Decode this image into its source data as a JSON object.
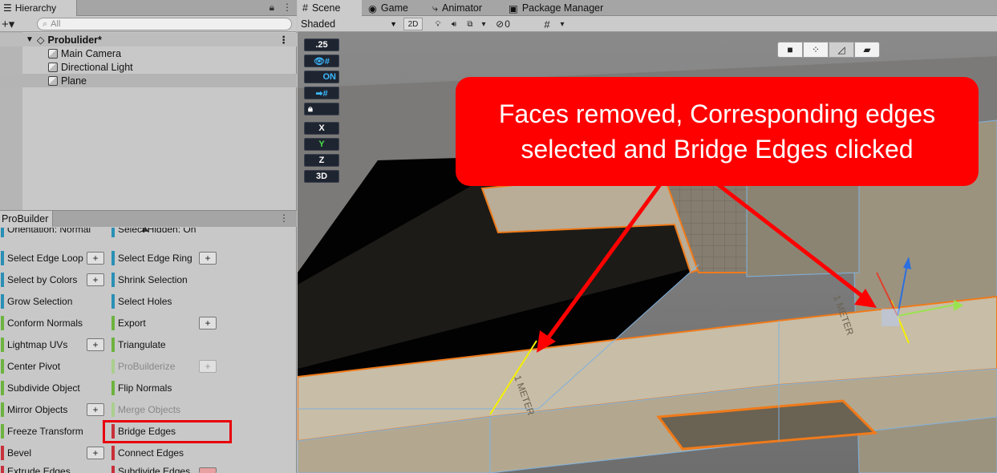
{
  "hierarchy": {
    "tab_label": "Hierarchy",
    "add_label": "+▾",
    "search_placeholder": "All",
    "scene_name": "Probulider*",
    "items": [
      {
        "label": "Main Camera"
      },
      {
        "label": "Directional Light"
      },
      {
        "label": "Plane"
      }
    ]
  },
  "probuilder": {
    "tab_label": "ProBuilder",
    "partial_left": "Orientation: Normal",
    "partial_right": "Select Hidden: On",
    "left_items": [
      {
        "label": "Select Edge Loop",
        "has_plus": true
      },
      {
        "label": "Select by Colors",
        "has_plus": true
      },
      {
        "label": "Grow Selection",
        "has_plus": false
      },
      {
        "label": "Conform Normals",
        "has_plus": false
      },
      {
        "label": "Lightmap UVs",
        "has_plus": true
      },
      {
        "label": "Center Pivot",
        "has_plus": false
      },
      {
        "label": "Subdivide Object",
        "has_plus": false
      },
      {
        "label": "Mirror Objects",
        "has_plus": true
      },
      {
        "label": "Freeze Transform",
        "has_plus": false
      },
      {
        "label": "Bevel",
        "has_plus": true
      },
      {
        "label": "Extrude Edges",
        "has_plus": false
      }
    ],
    "right_items": [
      {
        "label": "Select Edge Ring",
        "has_plus": true
      },
      {
        "label": "Shrink Selection",
        "has_plus": false
      },
      {
        "label": "Select Holes",
        "has_plus": false
      },
      {
        "label": "Export",
        "has_plus": true
      },
      {
        "label": "Triangulate",
        "has_plus": false
      },
      {
        "label": "ProBuilderize",
        "has_plus": true
      },
      {
        "label": "Flip Normals",
        "has_plus": false
      },
      {
        "label": "Merge Objects",
        "has_plus": false
      },
      {
        "label": "Bridge Edges",
        "has_plus": false
      },
      {
        "label": "Connect Edges",
        "has_plus": false
      },
      {
        "label": "Subdivide Edges",
        "has_plus": true
      }
    ],
    "plus_label": "+"
  },
  "scene": {
    "tabs": [
      {
        "label": "Scene",
        "icon": "grid-icon"
      },
      {
        "label": "Game",
        "icon": "gamepad-icon"
      },
      {
        "label": "Animator",
        "icon": "animator-icon"
      },
      {
        "label": "Package Manager",
        "icon": "package-icon"
      }
    ],
    "shading_mode": "Shaded",
    "mode_2d": "2D",
    "hidden_count": "0",
    "snap_value": ".25",
    "toggle_on": "ON",
    "axis_x": "X",
    "axis_y": "Y",
    "axis_z": "Z",
    "view_3d": "3D",
    "texture_label": "1 METER"
  },
  "annotation": {
    "callout_text": "Faces removed, Corresponding edges selected and Bridge Edges clicked",
    "color": "#ff0000"
  },
  "colors": {
    "teal_bar": "#2a8fb5",
    "green_bar": "#6db33f",
    "red_bar": "#c8303a",
    "selection_orange": "#f07a1a",
    "edge_blue": "#7fb2e0"
  }
}
